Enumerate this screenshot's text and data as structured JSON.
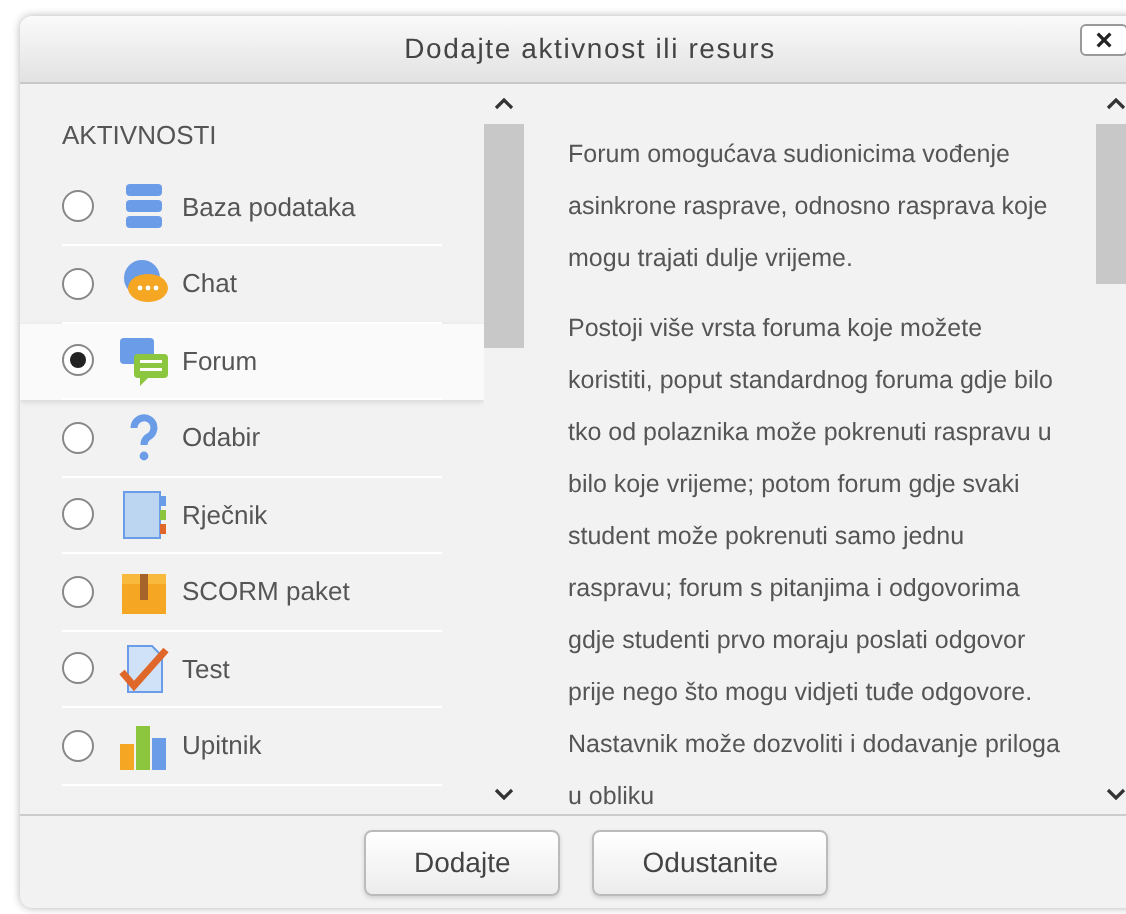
{
  "dialog": {
    "title": "Dodajte aktivnost ili resurs",
    "close": "×"
  },
  "section": "AKTIVNOSTI",
  "items": [
    {
      "label": "Baza podataka",
      "selected": false
    },
    {
      "label": "Chat",
      "selected": false
    },
    {
      "label": "Forum",
      "selected": true
    },
    {
      "label": "Odabir",
      "selected": false
    },
    {
      "label": "Rječnik",
      "selected": false
    },
    {
      "label": "SCORM paket",
      "selected": false
    },
    {
      "label": "Test",
      "selected": false
    },
    {
      "label": "Upitnik",
      "selected": false
    }
  ],
  "description": [
    "Forum omogućava sudionicima vođenje asinkrone rasprave, odnosno rasprava koje mogu trajati dulje vrijeme.",
    "Postoji više vrsta foruma koje možete koristiti, poput standardnog foruma gdje bilo tko od polaznika može pokrenuti raspravu u bilo koje vrijeme; potom forum gdje svaki student može pokrenuti samo jednu raspravu; forum s pitanjima i odgovorima gdje studenti prvo moraju poslati odgovor prije nego što mogu vidjeti tuđe odgovore. Nastavnik može dozvoliti i dodavanje priloga u obliku"
  ],
  "buttons": [
    "Dodajte",
    "Odustanite"
  ]
}
